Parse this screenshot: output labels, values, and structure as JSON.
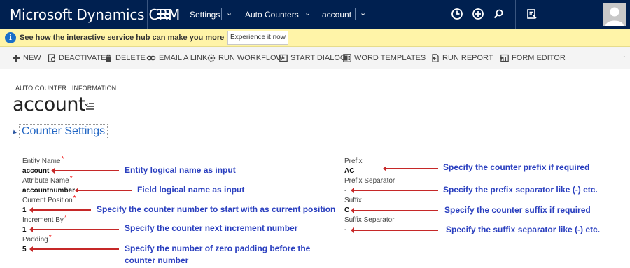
{
  "app": {
    "brand": "Microsoft Dynamics CRM",
    "nav": [
      "Settings",
      "Auto Counters",
      "account"
    ],
    "icons": [
      "recent-clock-icon",
      "create-plus-icon",
      "search-icon",
      "advanced-find-icon",
      "user-avatar"
    ]
  },
  "notification": {
    "message": "See how the interactive service hub can make you more productive.",
    "button": "Experience it now"
  },
  "commands": [
    {
      "label": "NEW",
      "icon": "plus-icon"
    },
    {
      "label": "DEACTIVATE",
      "icon": "deactivate-icon"
    },
    {
      "label": "DELETE",
      "icon": "trash-icon"
    },
    {
      "label": "EMAIL A LINK",
      "icon": "link-icon"
    },
    {
      "label": "RUN WORKFLOW",
      "icon": "workflow-icon"
    },
    {
      "label": "START DIALOG",
      "icon": "dialog-icon"
    },
    {
      "label": "WORD TEMPLATES",
      "icon": "word-icon",
      "dropdown": true
    },
    {
      "label": "RUN REPORT",
      "icon": "report-icon",
      "dropdown": true
    },
    {
      "label": "FORM EDITOR",
      "icon": "form-editor-icon"
    }
  ],
  "form": {
    "breadcrumb": "AUTO COUNTER : INFORMATION",
    "title": "account",
    "section": "Counter Settings"
  },
  "fields_left": [
    {
      "label": "Entity Name",
      "required": "*",
      "value": "account"
    },
    {
      "label": "Attribute Name",
      "required": "*",
      "value": "accountnumber"
    },
    {
      "label": "Current Position",
      "required": "*",
      "value": "1"
    },
    {
      "label": "Increment By",
      "required": "*",
      "value": "1"
    },
    {
      "label": "Padding",
      "required": "*",
      "value": "5"
    }
  ],
  "fields_right": [
    {
      "label": "Prefix",
      "value": "AC"
    },
    {
      "label": "Prefix Separator",
      "value": "-"
    },
    {
      "label": "Suffix",
      "value": "C"
    },
    {
      "label": "Suffix Separator",
      "value": "-"
    }
  ],
  "annotations": {
    "entity": "Entity logical name as input",
    "attribute": "Field logical name as input",
    "position": "Specify the counter number to start with as current position",
    "increment": "Specify the counter next increment number",
    "padding_1": "Specify the number of zero padding before the",
    "padding_2": "counter number",
    "prefix": "Specify the counter prefix if required",
    "prefix_sep": "Specify the prefix separator like (-) etc.",
    "suffix": "Specify the counter suffix if required",
    "suffix_sep": "Specify the suffix separator like (-) etc."
  },
  "colors": {
    "topbar": "#002050",
    "notification": "#fff4a8",
    "annotation_text": "#2a3fbf",
    "annotation_arrow": "#c62828",
    "section_link": "#2266c4",
    "required": "#ee0000"
  }
}
